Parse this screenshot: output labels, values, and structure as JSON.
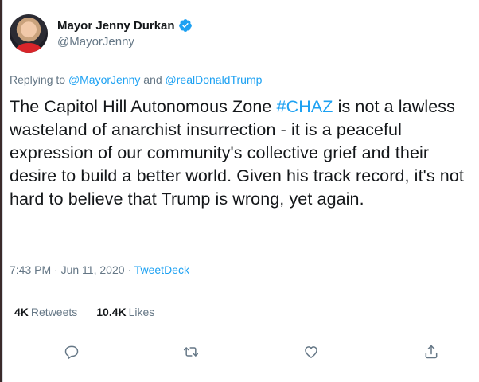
{
  "user": {
    "display_name": "Mayor Jenny Durkan",
    "handle": "@MayorJenny",
    "verified": true
  },
  "replying": {
    "prefix": "Replying to",
    "to1": "@MayorJenny",
    "and": "and",
    "to2": "@realDonaldTrump"
  },
  "tweet": {
    "text_before": "The Capitol Hill Autonomous Zone ",
    "hashtag": "#CHAZ",
    "text_after": " is not a lawless wasteland of anarchist insurrection - it is a peaceful expression of our community's collective grief and their desire to build a better world. Given his track record, it's not hard to believe that Trump is wrong, yet again."
  },
  "meta": {
    "time": "7:43 PM",
    "separator1": "·",
    "date": "Jun 11, 2020",
    "separator2": "·",
    "source": "TweetDeck"
  },
  "stats": {
    "retweets_count": "4K",
    "retweets_label": "Retweets",
    "likes_count": "10.4K",
    "likes_label": "Likes"
  },
  "icons": {
    "reply": "reply-icon",
    "retweet": "retweet-icon",
    "like": "heart-icon",
    "share": "share-icon",
    "verified": "verified-badge-icon"
  },
  "colors": {
    "link": "#1da1f2",
    "muted": "#657786",
    "text": "#14171a"
  }
}
